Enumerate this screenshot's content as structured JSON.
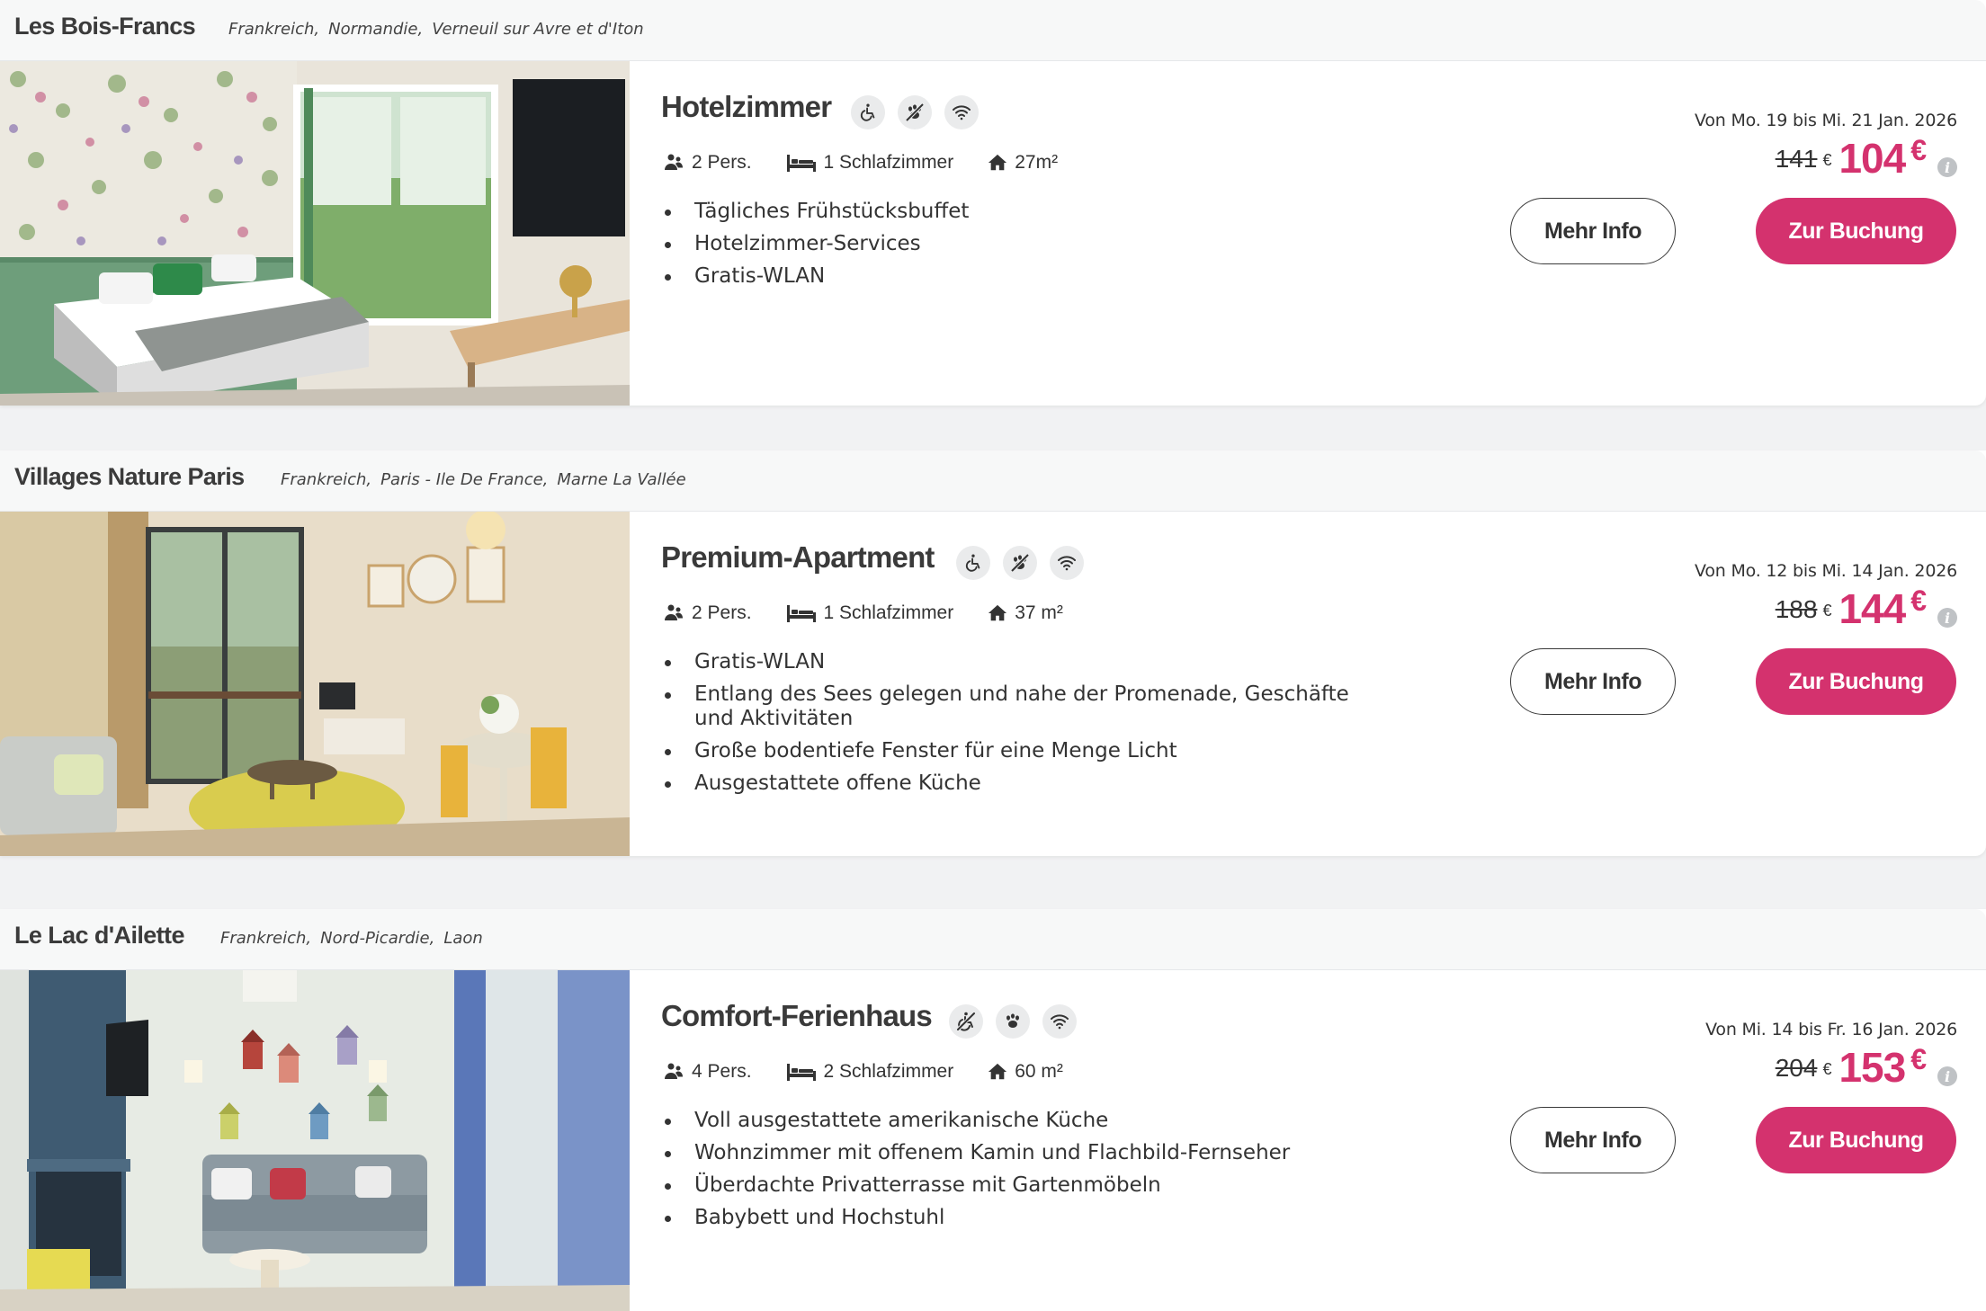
{
  "listings": [
    {
      "park": "Les Bois-Francs",
      "locations": [
        "Frankreich",
        "Normandie",
        "Verneuil sur Avre et d'Iton"
      ],
      "image_label": "Hotelzimmer photo",
      "room": "Hotelzimmer",
      "amenities": [
        {
          "icon": "wheelchair-icon",
          "label": "Rollstuhlgerecht"
        },
        {
          "icon": "no-pets-icon",
          "label": "Keine Haustiere"
        },
        {
          "icon": "wifi-icon",
          "label": "WLAN"
        }
      ],
      "persons": "2 Pers.",
      "bedrooms": "1 Schlafzimmer",
      "area": "27m²",
      "features": [
        "Tägliches Frühstücksbuffet",
        "Hotelzimmer-Services",
        "Gratis-WLAN"
      ],
      "dates": "Von Mo. 19 bis Mi. 21 Jan. 2026",
      "old_price": "141",
      "new_price": "104",
      "currency": "€",
      "more_info": "Mehr Info",
      "book": "Zur Buchung"
    },
    {
      "park": "Villages Nature Paris",
      "locations": [
        "Frankreich",
        "Paris - Ile De France",
        "Marne La Vallée"
      ],
      "room": "Premium-Apartment",
      "amenities": [
        {
          "icon": "wheelchair-icon",
          "label": "Rollstuhlgerecht"
        },
        {
          "icon": "no-pets-icon",
          "label": "Keine Haustiere"
        },
        {
          "icon": "wifi-icon",
          "label": "WLAN"
        }
      ],
      "persons": "2 Pers.",
      "bedrooms": "1 Schlafzimmer",
      "area": "37 m²",
      "features": [
        "Gratis-WLAN",
        "Entlang des Sees gelegen und nahe der Promenade, Geschäfte und Aktivitäten",
        "Große bodentiefe Fenster für eine Menge Licht",
        "Ausgestattete offene Küche"
      ],
      "dates": "Von Mo. 12 bis Mi. 14 Jan. 2026",
      "old_price": "188",
      "new_price": "144",
      "currency": "€",
      "more_info": "Mehr Info",
      "book": "Zur Buchung"
    },
    {
      "park": "Le Lac d'Ailette",
      "locations": [
        "Frankreich",
        "Nord-Picardie",
        "Laon"
      ],
      "room": "Comfort-Ferienhaus",
      "amenities": [
        {
          "icon": "not-wheelchair-icon",
          "label": "Nicht rollstuhlgerecht"
        },
        {
          "icon": "pets-allowed-icon",
          "label": "Haustiere erlaubt"
        },
        {
          "icon": "wifi-icon",
          "label": "WLAN"
        }
      ],
      "persons": "4 Pers.",
      "bedrooms": "2 Schlafzimmer",
      "area": "60 m²",
      "features": [
        "Voll ausgestattete amerikanische Küche",
        "Wohnzimmer mit offenem Kamin und Flachbild-Fernseher",
        "Überdachte Privatterrasse mit Gartenmöbeln",
        "Babybett und Hochstuhl"
      ],
      "dates": "Von Mi. 14 bis Fr. 16 Jan. 2026",
      "old_price": "204",
      "new_price": "153",
      "currency": "€",
      "more_info": "Mehr Info",
      "book": "Zur Buchung"
    }
  ]
}
